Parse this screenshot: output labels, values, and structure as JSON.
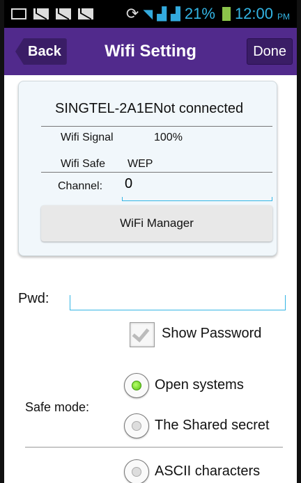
{
  "status_bar": {
    "icons": [
      "image-icon",
      "mail-icon",
      "mail-icon",
      "mail-icon",
      "sync-icon",
      "wifi-icon",
      "signal-icon",
      "signal-icon",
      "battery-icon"
    ],
    "battery": "21%",
    "time": "12:00",
    "ampm": "PM"
  },
  "header": {
    "back_label": "Back",
    "title": "Wifi Setting",
    "done_label": "Done",
    "accent_color": "#512a8c"
  },
  "network": {
    "ssid_status": "SINGTEL-2A1ENot connected",
    "signal_label": "Wifi Signal",
    "signal_value": "100%",
    "safe_label": "Wifi Safe",
    "safe_value": "WEP",
    "channel_label": "Channel:",
    "channel_value": "0",
    "manager_button": "WiFi Manager"
  },
  "password": {
    "label": "Pwd:",
    "value": "",
    "show_label": "Show Password",
    "show_checked": true
  },
  "safe_mode": {
    "label": "Safe mode:",
    "options": [
      {
        "label": "Open systems",
        "selected": true
      },
      {
        "label": "The Shared secret",
        "selected": false
      }
    ]
  },
  "encoding": {
    "options": [
      {
        "label": "ASCII characters",
        "selected": false
      }
    ]
  }
}
